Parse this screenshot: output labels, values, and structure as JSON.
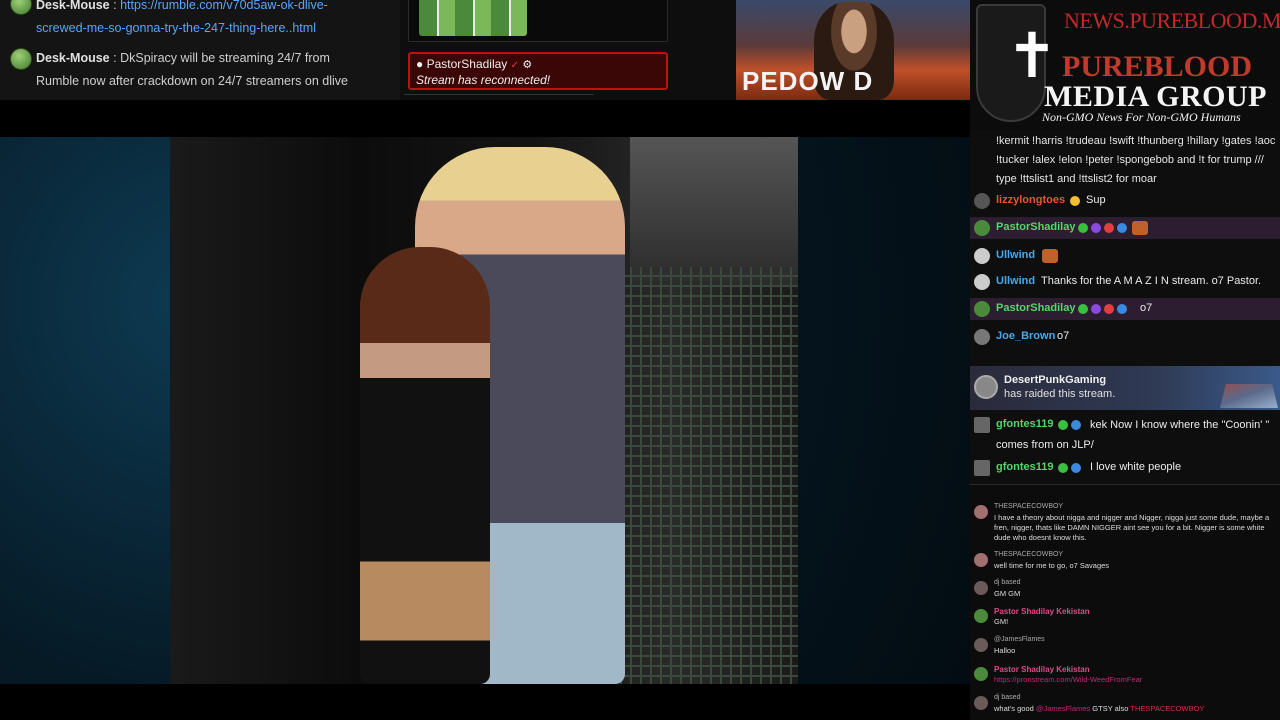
{
  "top_chat": {
    "rows": [
      {
        "user": "Desk-Mouse",
        "separator": ":",
        "text": "https://rumble.com/v70d5aw-ok-dlive-",
        "text2": "screwed-me-so-gonna-try-the-247-thing-here..html"
      },
      {
        "user": "Desk-Mouse",
        "separator": ":",
        "text": "DkSpiracy will be streaming 24/7 from",
        "text2": "Rumble now after crackdown on 24/7 streamers on dlive"
      }
    ]
  },
  "alert": {
    "user": "PastorShadilay",
    "verified": "✓",
    "gear": "⚙",
    "message": "Stream has reconnected!"
  },
  "promo": {
    "text": "PEDOW D"
  },
  "brand": {
    "url": "NEWS.PUREBLOOD.MEDIA",
    "cross": "✝",
    "name_line1": "PUREBLOOD",
    "name_line2": "MEDIA GROUP",
    "tagline": "Non-GMO News For Non-GMO Humans"
  },
  "side_chat": {
    "info_text": "!kermit !harris !trudeau !swift !thunberg !hillary !gates !aoc !tucker !alex !elon !peter !spongebob and !t for trump /// type !ttslist1 and !ttslist2 for moar",
    "messages": [
      {
        "user": "lizzylongtoes",
        "text": "Sup",
        "color": "#e8533a"
      },
      {
        "user": "PastorShadilay",
        "text": "",
        "color": "#55d66b"
      },
      {
        "user": "Ullwind",
        "text": "",
        "color": "#4aa8e8"
      },
      {
        "user": "Ullwind",
        "text": "Thanks for the A M A Z I N stream. o7 Pastor.",
        "color": "#4aa8e8"
      },
      {
        "user": "PastorShadilay",
        "text": "o7",
        "color": "#55d66b"
      },
      {
        "user": "Joe_Brown",
        "text": "o7",
        "color": "#4aa8e8"
      }
    ],
    "raid": {
      "user": "DesertPunkGaming",
      "text": "has raided this stream."
    },
    "after_raid": [
      {
        "user": "gfontes119",
        "text": "kek Now I know where the \"Coonin' \" comes from on JLP/",
        "color": "#55d66b"
      },
      {
        "user": "gfontes119",
        "text": "I love white people",
        "color": "#55d66b"
      }
    ]
  },
  "lower_chat": {
    "messages": [
      {
        "user": "THESPACECOWBOY",
        "text": "I have a theory about nigga and nigger and Nigger, nigga just some dude, maybe a fren, nigger, thats like DAMN NIGGER aint see you for a bit. Nigger is some white dude who doesnt know this.",
        "pink": false
      },
      {
        "user": "THESPACECOWBOY",
        "text": "well time for me to go, o7 Savages",
        "pink": false
      },
      {
        "user": "dj based",
        "text": "GM GM",
        "pink": false
      },
      {
        "user": "Pastor Shadilay Kekistan",
        "text": "GM!",
        "pink": true
      },
      {
        "user": "@JamesFlames",
        "text": "Halloo",
        "pink": false
      },
      {
        "user": "Pastor Shadilay Kekistan",
        "text": "https://pronstream.com/Wild-WeedFromFear",
        "pink": true
      },
      {
        "user": "dj based",
        "text": "what's good",
        "mention": "@JamesFlames",
        "text2": "GTSY also",
        "mention2": "THESPACECOWBOY",
        "pink": false
      }
    ]
  },
  "colors": {
    "alert_border": "#c01010",
    "brand_red": "#c0392b",
    "link_blue": "#58a6ff",
    "highlight_row": "#2c1e30"
  }
}
